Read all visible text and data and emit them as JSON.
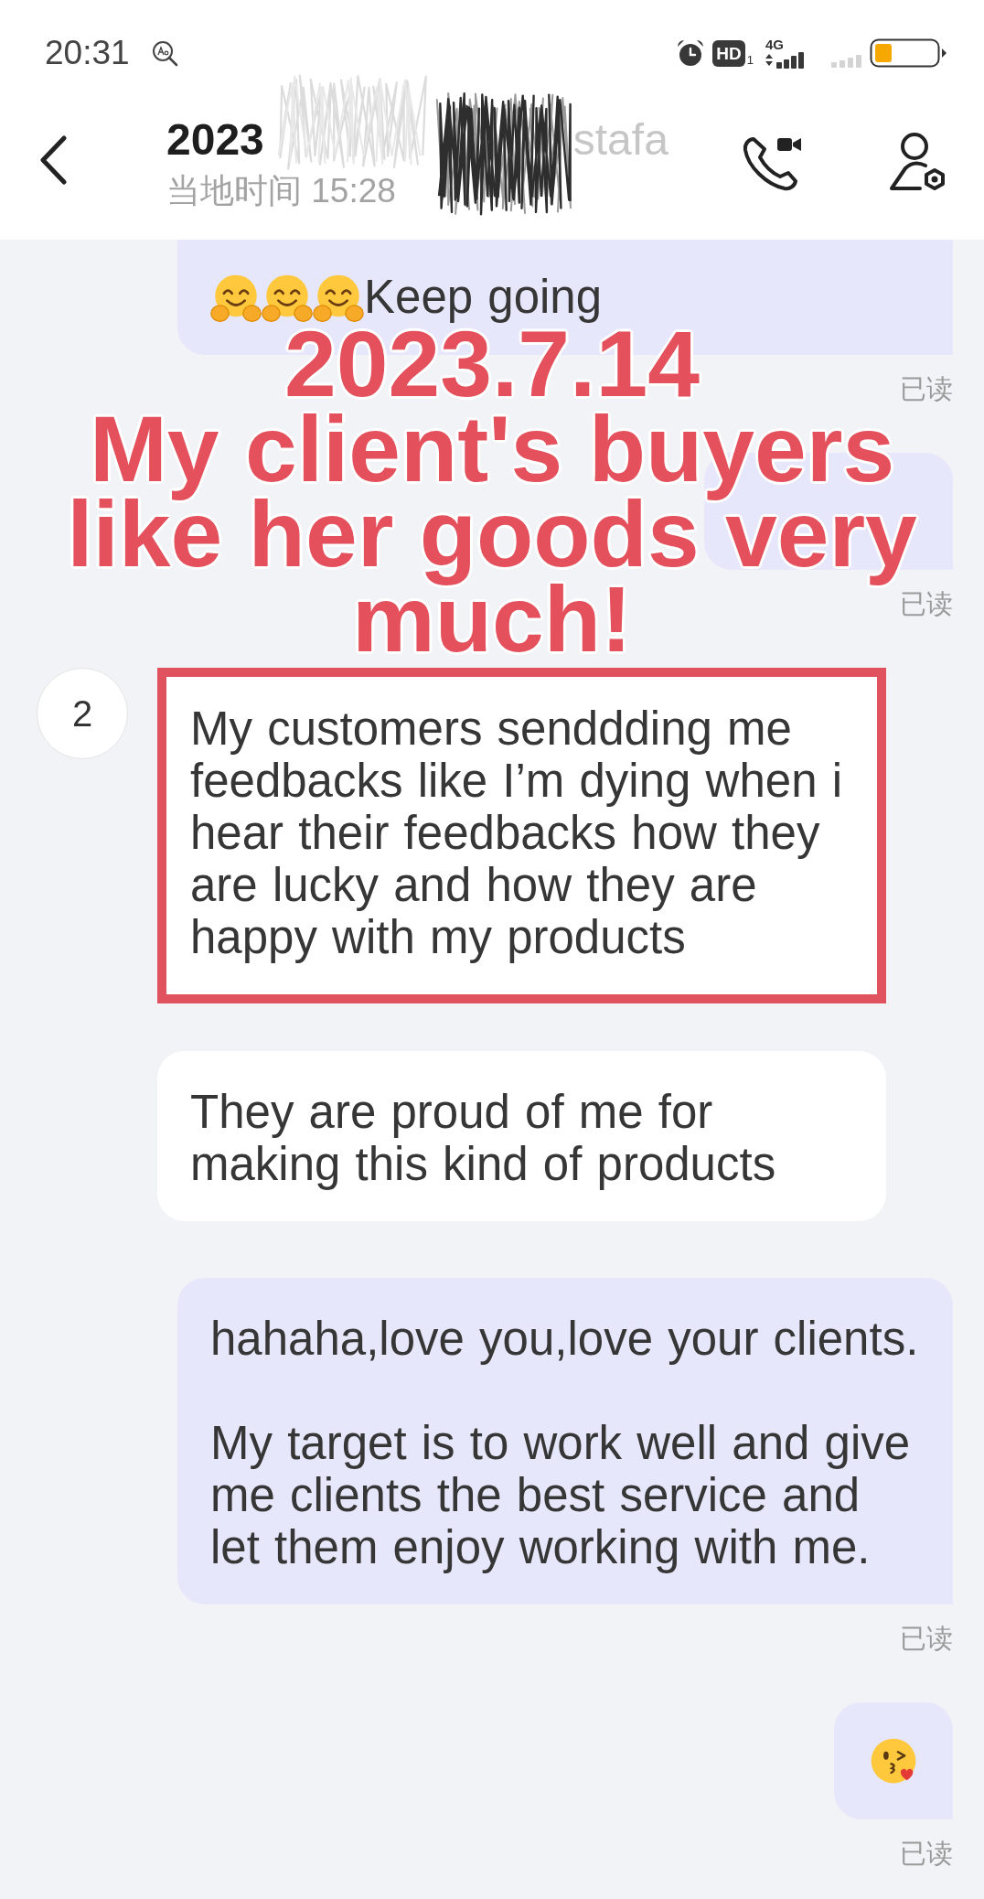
{
  "status_bar": {
    "time": "20:31",
    "hd_label": "HD",
    "sim_slot": "1",
    "network": "4G"
  },
  "header": {
    "title_fragments": [
      {
        "text": "2023",
        "obscured": false
      },
      {
        "text": "stafa",
        "obscured": true
      }
    ],
    "subtitle": "当地时间 15:28"
  },
  "messages": [
    {
      "outgoing": true,
      "clipped": true,
      "highlighted": false,
      "emojis": [
        {
          "kind": "hugging"
        },
        {
          "kind": "hugging"
        },
        {
          "kind": "hugging"
        }
      ],
      "text": "Keep going",
      "receipt": "已读"
    },
    {
      "outgoing": true,
      "clipped": false,
      "highlighted": false,
      "receipt": "已读"
    },
    {
      "outgoing": false,
      "clipped": false,
      "highlighted": true,
      "avatar": "2",
      "text": "My customers senddding me feedbacks like I’m dying when i hear their feedbacks how they are lucky and how they are happy with my products"
    },
    {
      "outgoing": false,
      "clipped": false,
      "highlighted": false,
      "text": "They are proud of me for making this kind of products"
    },
    {
      "outgoing": true,
      "clipped": false,
      "highlighted": false,
      "text": "hahaha,love you,love your clients.\n\nMy target is to work well and give me clients the best service and let them enjoy working with me.",
      "receipt": "已读"
    },
    {
      "outgoing": true,
      "clipped": false,
      "highlighted": false,
      "emojis": [
        {
          "kind": "kissing"
        }
      ],
      "receipt": "已读"
    }
  ],
  "caption": {
    "lines": [
      "2023.7.14",
      "My client's buyers",
      "like her goods very",
      "much!"
    ]
  }
}
